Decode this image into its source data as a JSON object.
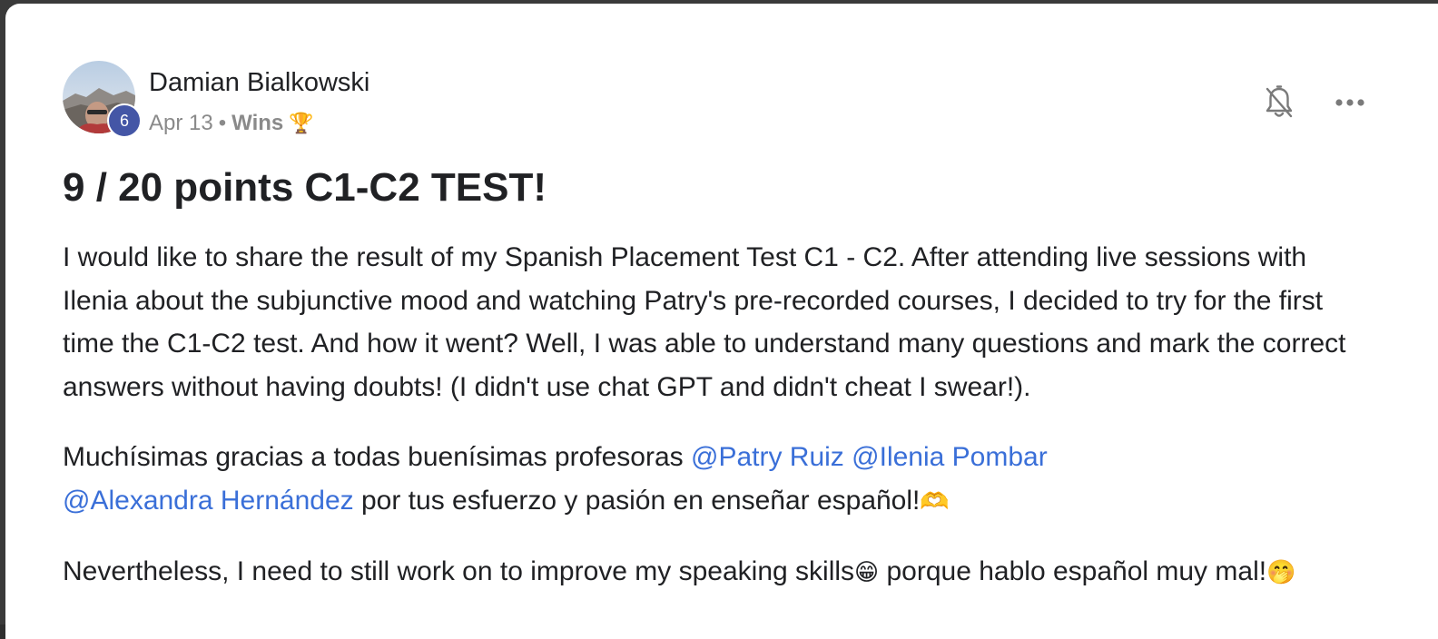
{
  "post": {
    "author": {
      "name": "Damian Bialkowski",
      "level": "6",
      "avatar": "avatar-mountain-photo"
    },
    "date": "Apr 13",
    "separator": "•",
    "category": "Wins",
    "category_emoji": "🏆",
    "title": "9 / 20 points C1-C2 TEST!",
    "paragraph1": "I would like to share the result of my Spanish Placement Test C1 - C2. After attending live sessions with Ilenia about the subjunctive mood and watching Patry's pre-recorded courses, I decided to try for the first time the C1-C2 test. And how it went? Well, I was able to understand many questions and mark the correct answers without having doubts! (I didn't use chat GPT and didn't cheat I swear!).",
    "paragraph2": {
      "text_before": "Muchísimas gracias a todas buenísimas profesoras ",
      "mentions": [
        "@Patry Ruiz",
        "@Ilenia Pombar",
        "@Alexandra Hernández"
      ],
      "text_after": " por tus esfuerzo y pasión en enseñar español!",
      "emoji": "🫶"
    },
    "paragraph3": {
      "text_before": "Nevertheless, I need to still work on to improve my speaking skills",
      "emoji1": "😁",
      "text_after": " porque hablo español muy mal!",
      "emoji2": "🤭"
    }
  },
  "icons": {
    "notifications": "bell-off-icon",
    "more": "more-horizontal-icon"
  },
  "colors": {
    "mention": "#3a6fd8",
    "level_badge": "#4456a6",
    "meta_text": "#8a8a8a",
    "text": "#202124"
  }
}
